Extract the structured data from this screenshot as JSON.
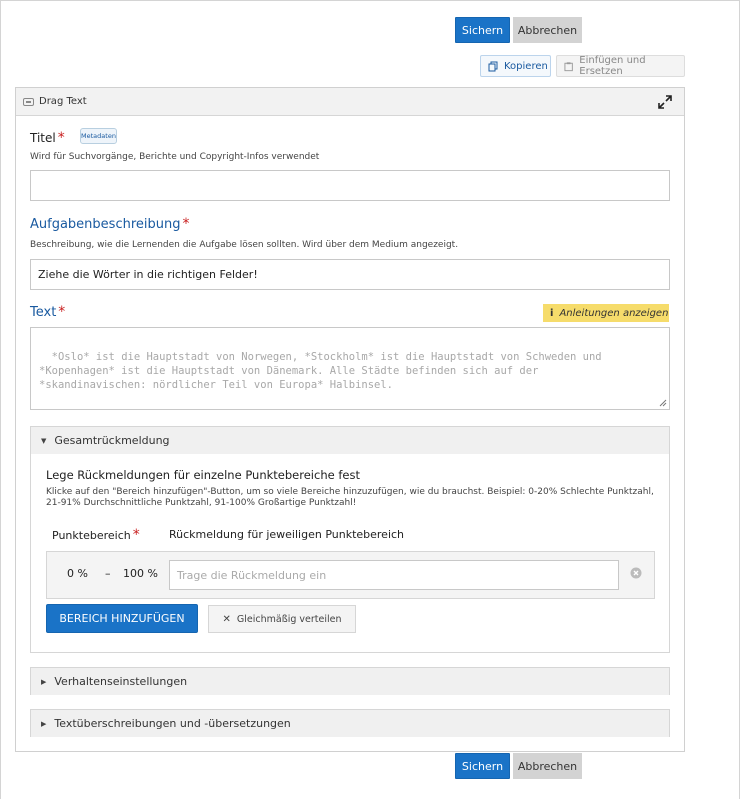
{
  "actions": {
    "save_label": "Sichern",
    "cancel_label": "Abbrechen"
  },
  "clipboard": {
    "copy_label": "Kopieren",
    "paste_label": "Einfügen und Ersetzen"
  },
  "content_type": {
    "title": "Drag Text",
    "icon": "library-icon",
    "expand_icon": "expand-icon"
  },
  "fields": {
    "title": {
      "label": "Titel",
      "required_mark": "*",
      "tag": "Metadaten",
      "description": "Wird für Suchvorgänge, Berichte und Copyright-Infos verwendet",
      "value": ""
    },
    "task": {
      "label": "Aufgabenbeschreibung",
      "required_mark": "*",
      "description": "Beschreibung, wie die Lernenden die Aufgabe lösen sollten. Wird über dem Medium angezeigt.",
      "value": "Ziehe die Wörter in die richtigen Felder!"
    },
    "text": {
      "label": "Text",
      "required_mark": "*",
      "hint_label": "Anleitungen anzeigen",
      "placeholder": "*Oslo* ist die Hauptstadt von Norwegen, *Stockholm* ist die Hauptstadt von Schweden und\n*Kopenhagen* ist die Hauptstadt von Dänemark. Alle Städte befinden sich auf der\n*skandinavischen: nördlicher Teil von Europa* Halbinsel."
    }
  },
  "overall_feedback": {
    "section_title": "Gesamtrückmeldung",
    "heading": "Lege Rückmeldungen für einzelne Punktebereiche fest",
    "description": "Klicke auf den \"Bereich hinzufügen\"-Button, um so viele Bereiche hinzuzufügen, wie du brauchst. Beispiel: 0-20% Schlechte Punktzahl, 21-91% Durchschnittliche Punktzahl, 91-100% Großartige Punktzahl!",
    "col_range": "Punktebereich",
    "col_range_required": "*",
    "col_feedback": "Rückmeldung für jeweiligen Punktebereich",
    "range": {
      "from": "0 %",
      "dash": "–",
      "to": "100 %",
      "placeholder": "Trage die Rückmeldung ein"
    },
    "add_label": "BEREICH HINZUFÜGEN",
    "distribute_label": "Gleichmäßig verteilen"
  },
  "sections": {
    "behaviour": "Verhaltenseinstellungen",
    "translations": "Textüberschreibungen und -übersetzungen"
  },
  "colors": {
    "primary": "#1a73c7",
    "required": "#c81e1e",
    "hint": "#f6dc6b",
    "link": "#1a5aa0"
  }
}
